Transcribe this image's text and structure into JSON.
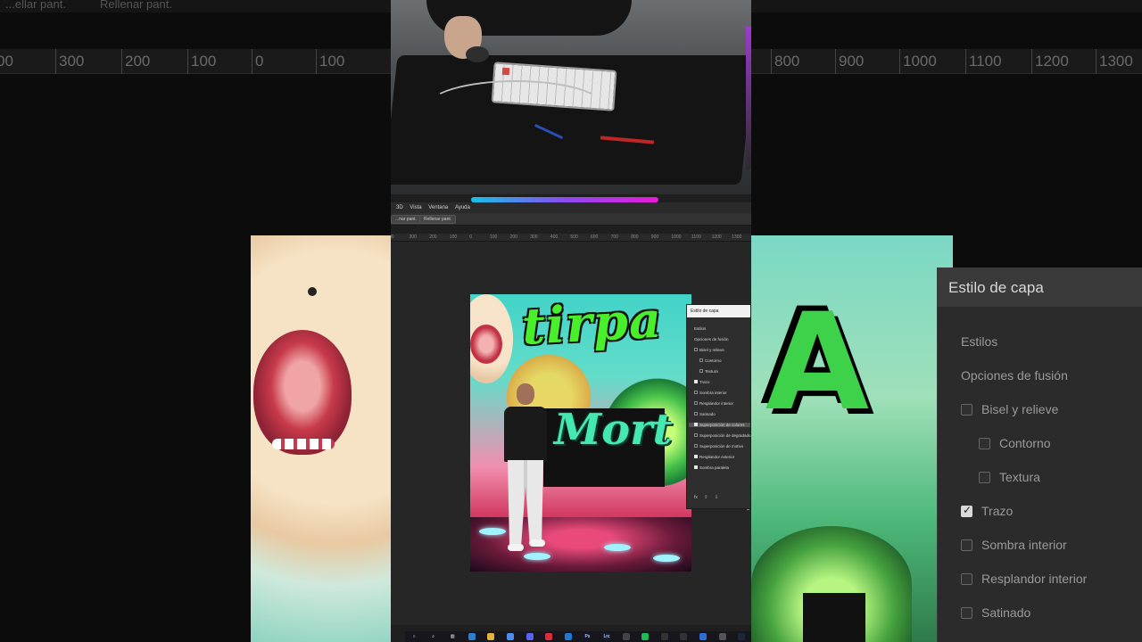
{
  "background_left": {
    "topbar_labels": [
      "...ellar pant.",
      "Rellenar pant."
    ],
    "ruler_labels": [
      "00",
      "300",
      "200",
      "100",
      "0",
      "100"
    ]
  },
  "background_right": {
    "ruler_labels": [
      "800",
      "900",
      "1000",
      "1100",
      "1200",
      "1300"
    ],
    "panel": {
      "title": "Estilo de capa",
      "items": [
        {
          "label": "Estilos",
          "checkbox": false,
          "checked": false,
          "indent": 0
        },
        {
          "label": "Opciones de fusión",
          "checkbox": false,
          "checked": false,
          "indent": 0
        },
        {
          "label": "Bisel y relieve",
          "checkbox": true,
          "checked": false,
          "indent": 1
        },
        {
          "label": "Contorno",
          "checkbox": true,
          "checked": false,
          "indent": 2
        },
        {
          "label": "Textura",
          "checkbox": true,
          "checked": false,
          "indent": 2
        },
        {
          "label": "Trazo",
          "checkbox": true,
          "checked": true,
          "indent": 1
        },
        {
          "label": "Sombra interior",
          "checkbox": true,
          "checked": false,
          "indent": 1
        },
        {
          "label": "Resplandor interior",
          "checkbox": true,
          "checked": false,
          "indent": 1
        },
        {
          "label": "Satinado",
          "checkbox": true,
          "checked": false,
          "indent": 1
        }
      ]
    }
  },
  "photoshop": {
    "menu": [
      "3D",
      "Vista",
      "Ventana",
      "Ayuda"
    ],
    "options_buttons": [
      "...nar pant.",
      "Rellenar pant."
    ],
    "ruler_labels": [
      "00",
      "300",
      "200",
      "100",
      "0",
      "100",
      "200",
      "300",
      "400",
      "500",
      "600",
      "700",
      "800",
      "900",
      "1000",
      "1100",
      "1200",
      "1300"
    ],
    "artwork": {
      "title_top": "tirpa",
      "title_bottom": "Mort"
    },
    "layer_style": {
      "title": "Estilo de capa",
      "items": [
        {
          "label": "Estilos",
          "checkbox": false,
          "checked": false,
          "indent": false,
          "highlight": false
        },
        {
          "label": "Opciones de fusión",
          "checkbox": false,
          "checked": false,
          "indent": false,
          "highlight": false
        },
        {
          "label": "Bisel y relieve",
          "checkbox": true,
          "checked": false,
          "indent": false,
          "highlight": false
        },
        {
          "label": "Contorno",
          "checkbox": true,
          "checked": false,
          "indent": true,
          "highlight": false
        },
        {
          "label": "Textura",
          "checkbox": true,
          "checked": false,
          "indent": true,
          "highlight": false
        },
        {
          "label": "Trazo",
          "checkbox": true,
          "checked": true,
          "indent": false,
          "highlight": false
        },
        {
          "label": "Sombra interior",
          "checkbox": true,
          "checked": false,
          "indent": false,
          "highlight": false
        },
        {
          "label": "Resplandor interior",
          "checkbox": true,
          "checked": false,
          "indent": false,
          "highlight": false
        },
        {
          "label": "Satinado",
          "checkbox": true,
          "checked": false,
          "indent": false,
          "highlight": false
        },
        {
          "label": "Superposición de colores",
          "checkbox": true,
          "checked": true,
          "indent": false,
          "highlight": true
        },
        {
          "label": "Superposición de degradado",
          "checkbox": true,
          "checked": false,
          "indent": false,
          "highlight": false
        },
        {
          "label": "Superposición de motivo",
          "checkbox": true,
          "checked": false,
          "indent": false,
          "highlight": false
        },
        {
          "label": "Resplandor exterior",
          "checkbox": true,
          "checked": true,
          "indent": false,
          "highlight": false
        },
        {
          "label": "Sombra paralela",
          "checkbox": true,
          "checked": true,
          "indent": false,
          "highlight": false
        }
      ],
      "footer": [
        "fx",
        "⇧",
        "⇩"
      ]
    },
    "taskbar_icons": [
      "windows-icon",
      "search-icon",
      "taskview-icon",
      "mail-icon",
      "files-icon",
      "chrome-icon",
      "discord-icon",
      "opera-icon",
      "vscode-icon",
      "photoshop-icon",
      "lightroom-icon",
      "app-icon",
      "spotify-icon",
      "github-icon",
      "gaming-icon",
      "browser-icon",
      "tool-icon",
      "steam-icon"
    ],
    "taskbar_labels": {
      "photoshop-icon": "Ps",
      "lightroom-icon": "Lrc"
    }
  },
  "colors": {
    "title_green": "#48ef2a",
    "mort_teal": "#45e8b0",
    "dialog_bg": "#2e2e2e",
    "accent_glow": "#8a4cf0"
  }
}
